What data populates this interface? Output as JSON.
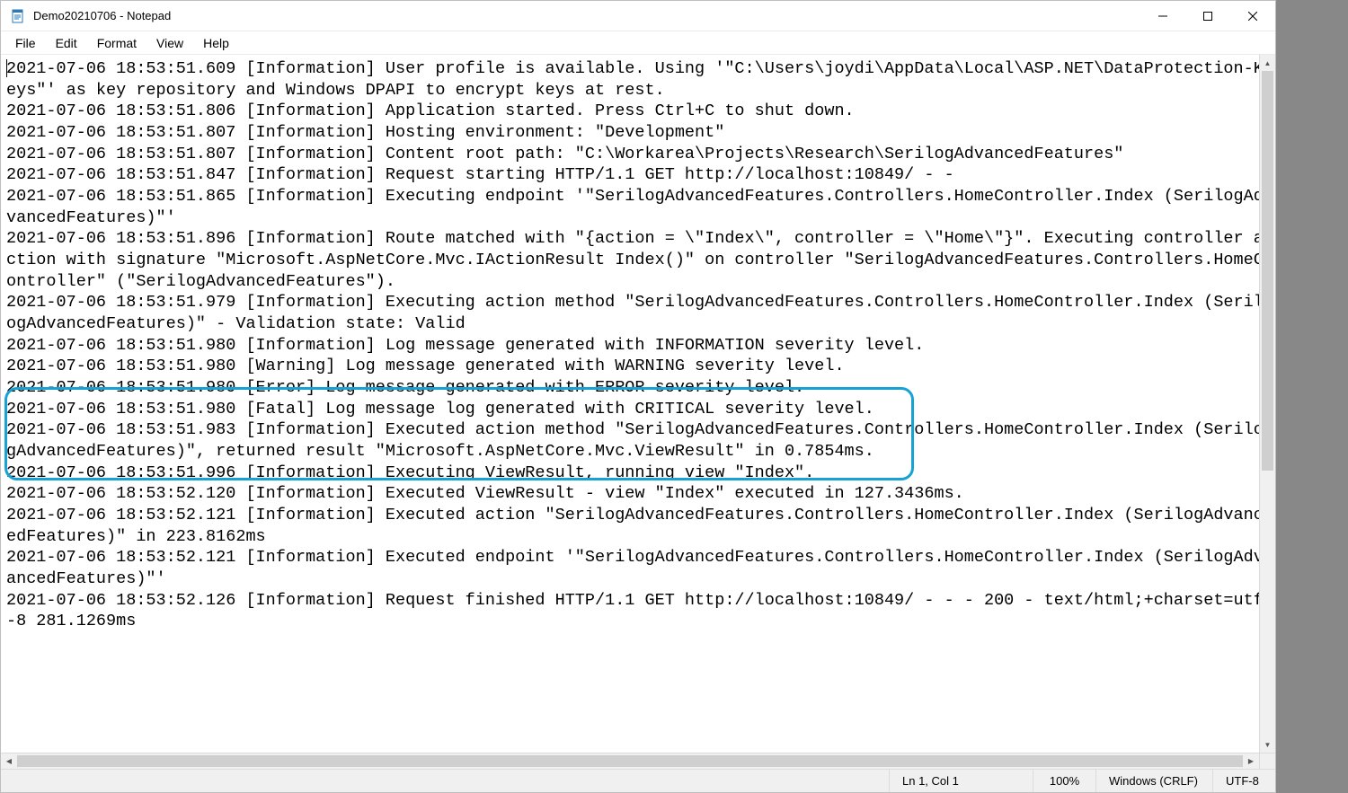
{
  "window": {
    "title": "Demo20210706 - Notepad"
  },
  "menu": {
    "file": "File",
    "edit": "Edit",
    "format": "Format",
    "view": "View",
    "help": "Help"
  },
  "editor": {
    "lines": [
      "2021-07-06 18:53:51.609 [Information] User profile is available. Using '\"C:\\Users\\joydi\\AppData\\Local\\ASP.NET\\DataProtection-Keys\"' as key repository and Windows DPAPI to encrypt keys at rest.",
      "2021-07-06 18:53:51.806 [Information] Application started. Press Ctrl+C to shut down.",
      "2021-07-06 18:53:51.807 [Information] Hosting environment: \"Development\"",
      "2021-07-06 18:53:51.807 [Information] Content root path: \"C:\\Workarea\\Projects\\Research\\SerilogAdvancedFeatures\"",
      "2021-07-06 18:53:51.847 [Information] Request starting HTTP/1.1 GET http://localhost:10849/ - -",
      "2021-07-06 18:53:51.865 [Information] Executing endpoint '\"SerilogAdvancedFeatures.Controllers.HomeController.Index (SerilogAdvancedFeatures)\"'",
      "2021-07-06 18:53:51.896 [Information] Route matched with \"{action = \\\"Index\\\", controller = \\\"Home\\\"}\". Executing controller action with signature \"Microsoft.AspNetCore.Mvc.IActionResult Index()\" on controller \"SerilogAdvancedFeatures.Controllers.HomeController\" (\"SerilogAdvancedFeatures\").",
      "2021-07-06 18:53:51.979 [Information] Executing action method \"SerilogAdvancedFeatures.Controllers.HomeController.Index (SerilogAdvancedFeatures)\" - Validation state: Valid",
      "2021-07-06 18:53:51.980 [Information] Log message generated with INFORMATION severity level.",
      "2021-07-06 18:53:51.980 [Warning] Log message generated with WARNING severity level.",
      "2021-07-06 18:53:51.980 [Error] Log message generated with ERROR severity level.",
      "2021-07-06 18:53:51.980 [Fatal] Log message log generated with CRITICAL severity level.",
      "2021-07-06 18:53:51.983 [Information] Executed action method \"SerilogAdvancedFeatures.Controllers.HomeController.Index (SerilogAdvancedFeatures)\", returned result \"Microsoft.AspNetCore.Mvc.ViewResult\" in 0.7854ms.",
      "2021-07-06 18:53:51.996 [Information] Executing ViewResult, running view \"Index\".",
      "2021-07-06 18:53:52.120 [Information] Executed ViewResult - view \"Index\" executed in 127.3436ms.",
      "2021-07-06 18:53:52.121 [Information] Executed action \"SerilogAdvancedFeatures.Controllers.HomeController.Index (SerilogAdvancedFeatures)\" in 223.8162ms",
      "2021-07-06 18:53:52.121 [Information] Executed endpoint '\"SerilogAdvancedFeatures.Controllers.HomeController.Index (SerilogAdvancedFeatures)\"'",
      "2021-07-06 18:53:52.126 [Information] Request finished HTTP/1.1 GET http://localhost:10849/ - - - 200 - text/html;+charset=utf-8 281.1269ms"
    ]
  },
  "status": {
    "position": "Ln 1, Col 1",
    "zoom": "100%",
    "line_ending": "Windows (CRLF)",
    "encoding": "UTF-8"
  }
}
